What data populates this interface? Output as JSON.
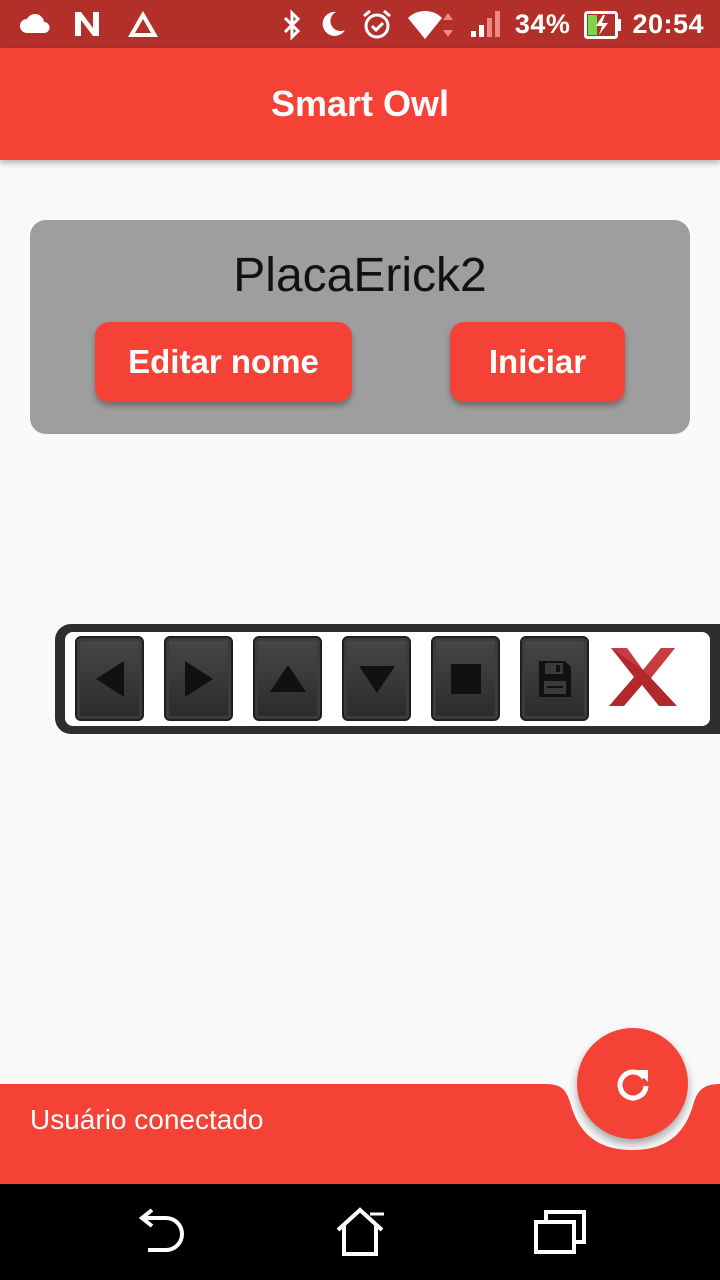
{
  "status_bar": {
    "left_icons": [
      "cloud-icon",
      "n-notification-icon",
      "warning-triangle-icon"
    ],
    "right_icons": [
      "bluetooth-icon",
      "moon-icon",
      "alarm-icon",
      "wifi-icon",
      "signal-icon"
    ],
    "battery_percent": "34%",
    "battery_level": 0.34,
    "time": "20:54"
  },
  "app_bar": {
    "title": "Smart Owl"
  },
  "device": {
    "name": "PlacaErick2",
    "edit_button": "Editar nome",
    "start_button": "Iniciar"
  },
  "toolbar": {
    "buttons": [
      "arrow-left-icon",
      "arrow-right-icon",
      "arrow-up-icon",
      "arrow-down-icon",
      "stop-icon",
      "save-icon"
    ],
    "close_icon": "close-x-icon"
  },
  "bottom_bar": {
    "status_message": "Usuário conectado",
    "fab_icon": "refresh-icon"
  },
  "nav_bar": {
    "icons": [
      "back-icon",
      "home-icon",
      "recents-icon"
    ]
  },
  "colors": {
    "primary": "#f44336",
    "status_bar": "#b3302a",
    "card": "#9e9e9e",
    "background": "#f9f9f9"
  }
}
